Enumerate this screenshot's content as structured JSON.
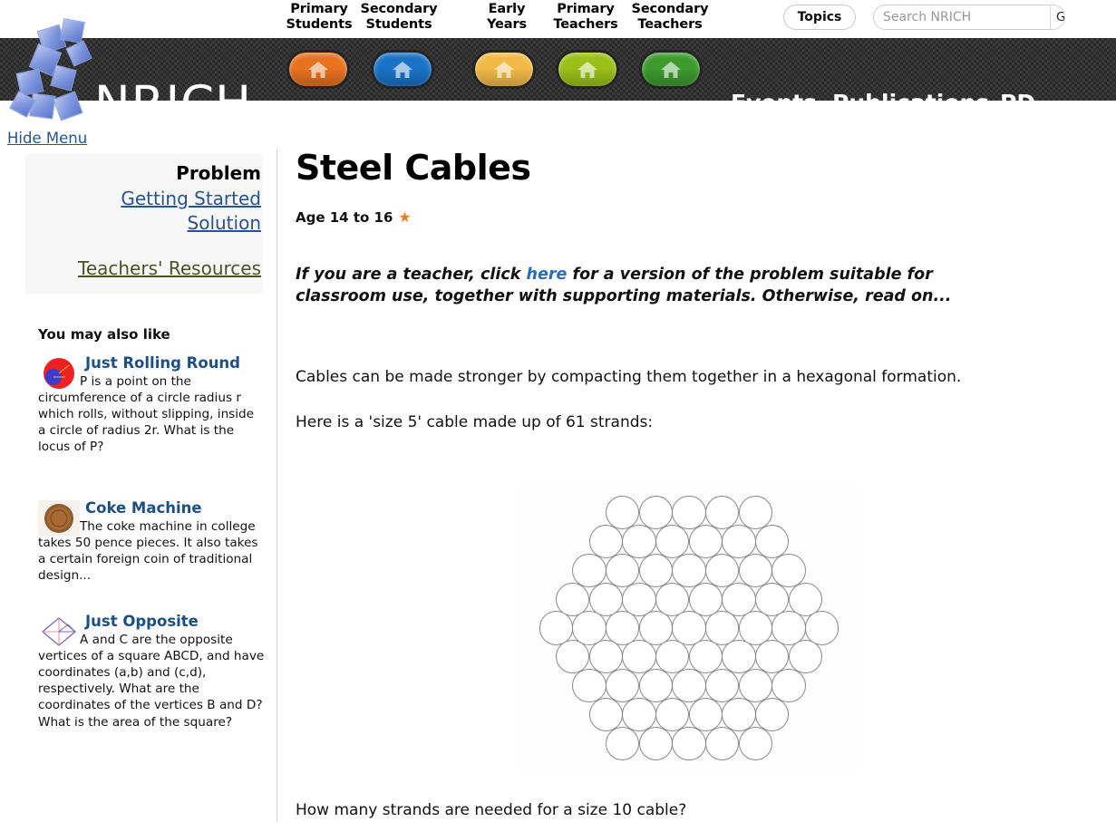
{
  "header": {
    "site_name": "NRICH",
    "audiences": [
      {
        "line1": "Primary",
        "line2": "Students",
        "icon": "home-icon",
        "color": "#e8731f",
        "active": false
      },
      {
        "line1": "Secondary",
        "line2": "Students",
        "icon": "home-icon",
        "color": "#1a73c7",
        "active": true
      },
      {
        "line1": "Early",
        "line2": "Years",
        "icon": "home-icon",
        "color": "#f2bb48",
        "active": false
      },
      {
        "line1": "Primary",
        "line2": "Teachers",
        "icon": "home-icon",
        "color": "#9cc01a",
        "active": false
      },
      {
        "line1": "Secondary",
        "line2": "Teachers",
        "icon": "home-icon",
        "color": "#3d9b2e",
        "active": false
      }
    ],
    "topics_label": "Topics",
    "search": {
      "value": "",
      "placeholder": "Search NRICH",
      "go_label": "Go"
    },
    "links": [
      {
        "label": "Events"
      },
      {
        "label": "Publications"
      },
      {
        "label": "PD"
      }
    ]
  },
  "hide_menu_label": "Hide Menu",
  "sidebar": {
    "menu": [
      {
        "label": "Problem",
        "type": "current"
      },
      {
        "label": "Getting Started",
        "type": "link"
      },
      {
        "label": "Solution",
        "type": "link"
      },
      {
        "label": "Teachers' Resources",
        "type": "resources"
      }
    ],
    "also_like_title": "You may also like",
    "related": [
      {
        "title": "Just Rolling Round",
        "thumb": "rolling-circles-icon",
        "description": "P is a point on the circumference of a circle radius r which rolls, without slipping, inside a circle of radius 2r. What is the locus of P?"
      },
      {
        "title": "Coke Machine",
        "thumb": "coin-icon",
        "description": "The coke machine in college takes 50 pence pieces. It also takes a certain foreign coin of traditional design..."
      },
      {
        "title": "Just Opposite",
        "thumb": "square-diagram-icon",
        "description": "A and C are the opposite vertices of a square ABCD, and have coordinates (a,b) and (c,d), respectively. What are the coordinates of the vertices B and D? What is the area of the square?"
      }
    ]
  },
  "main": {
    "title": "Steel Cables",
    "age_label": "Age 14 to 16",
    "stars": 1,
    "teacher_note": {
      "before": "If you are a teacher, click ",
      "link": "here",
      "after": " for a version of the problem suitable for classroom use, together with supporting materials. Otherwise, read on..."
    },
    "paragraph_1": "Cables can be made stronger by compacting them together in a hexagonal formation.",
    "paragraph_2": "Here is a 'size 5' cable made up of 61 strands:",
    "figure": {
      "alt": "size-5-hexagonal-cable-diagram",
      "rows": [
        5,
        6,
        7,
        8,
        9,
        8,
        7,
        6,
        5
      ],
      "total_strands": 61,
      "size": 5
    },
    "paragraph_3": "How many strands are needed for a size 10 cable?"
  }
}
